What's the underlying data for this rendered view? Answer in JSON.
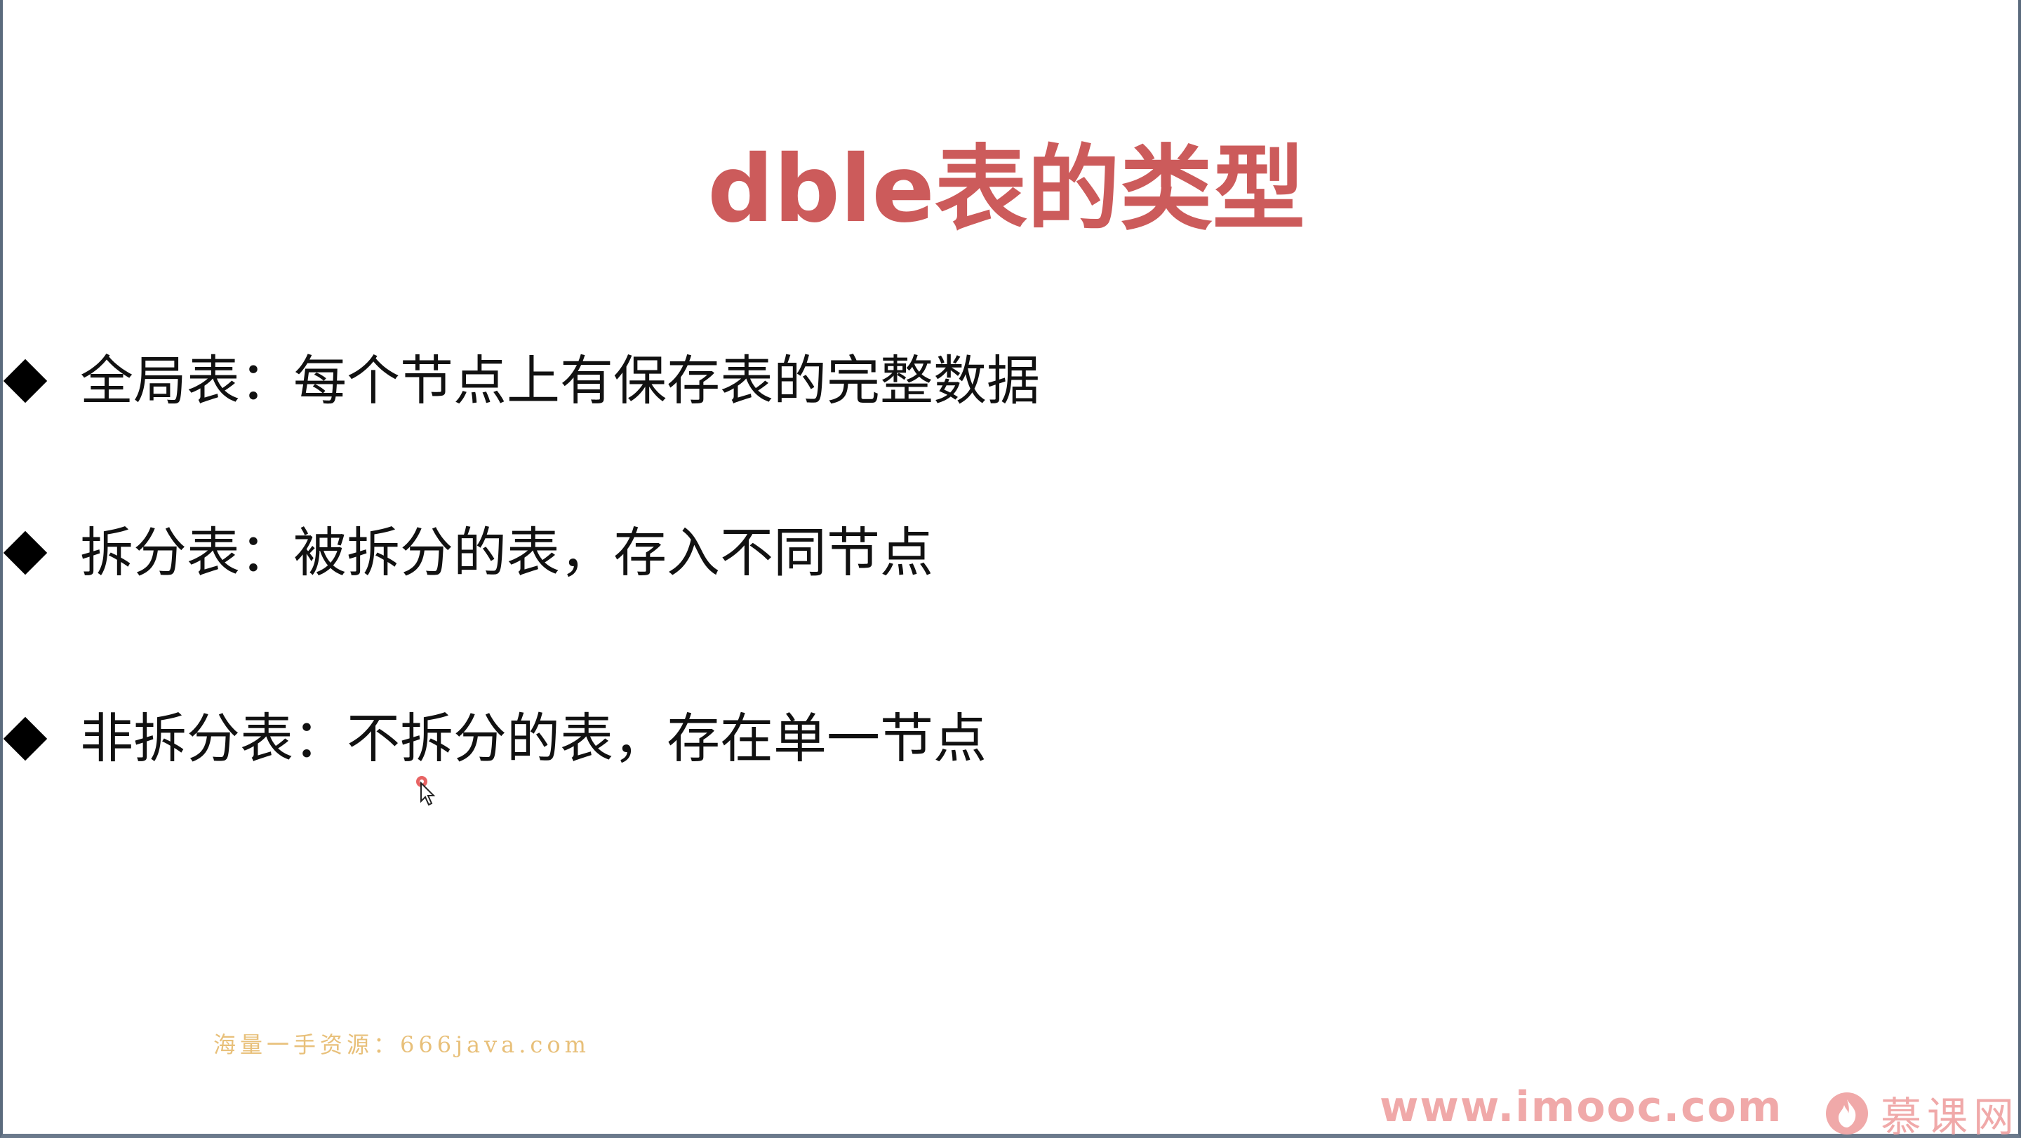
{
  "slide": {
    "title": "dble表的类型",
    "bullets": [
      {
        "text": "全局表：每个节点上有保存表的完整数据"
      },
      {
        "text": "拆分表：被拆分的表，存入不同节点"
      },
      {
        "text": "非拆分表：不拆分的表，存在单一节点"
      }
    ],
    "watermark": "海量一手资源：666java.com"
  },
  "branding": {
    "url": "www.imooc.com",
    "logo_text": "慕课网",
    "logo_icon": "flame-icon",
    "color": "#f0a9a9"
  },
  "colors": {
    "title": "#cc5b5b",
    "text": "#111111",
    "watermark": "#e8c07a"
  }
}
